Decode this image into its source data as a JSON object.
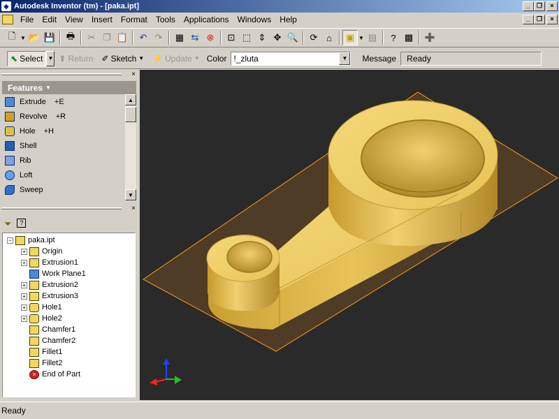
{
  "window": {
    "title": "Autodesk Inventor (tm) - [paka.ipt]"
  },
  "menu": [
    "File",
    "Edit",
    "View",
    "Insert",
    "Format",
    "Tools",
    "Applications",
    "Windows",
    "Help"
  ],
  "toolbar2": {
    "select_label": "Select",
    "return_label": "Return",
    "sketch_label": "Sketch",
    "update_label": "Update",
    "color_label": "Color",
    "color_value": "!_zluta",
    "message_label": "Message",
    "message_value": "Ready"
  },
  "features": {
    "header": "Features",
    "items": [
      {
        "label": "Extrude",
        "shortcut": "+E"
      },
      {
        "label": "Revolve",
        "shortcut": "+R"
      },
      {
        "label": "Hole",
        "shortcut": "+H"
      },
      {
        "label": "Shell",
        "shortcut": ""
      },
      {
        "label": "Rib",
        "shortcut": ""
      },
      {
        "label": "Loft",
        "shortcut": ""
      },
      {
        "label": "Sweep",
        "shortcut": ""
      }
    ]
  },
  "browser": {
    "root": "paka.ipt",
    "items": [
      "Origin",
      "Extrusion1",
      "Work Plane1",
      "Extrusion2",
      "Extrusion3",
      "Hole1",
      "Hole2",
      "Chamfer1",
      "Chamfer2",
      "Fillet1",
      "Fillet2",
      "End of Part"
    ]
  },
  "status": {
    "text": "Ready"
  },
  "colors": {
    "part": "#e8c050",
    "viewport_bg": "#2a2a2a",
    "title_gradient_start": "#0a246a"
  }
}
